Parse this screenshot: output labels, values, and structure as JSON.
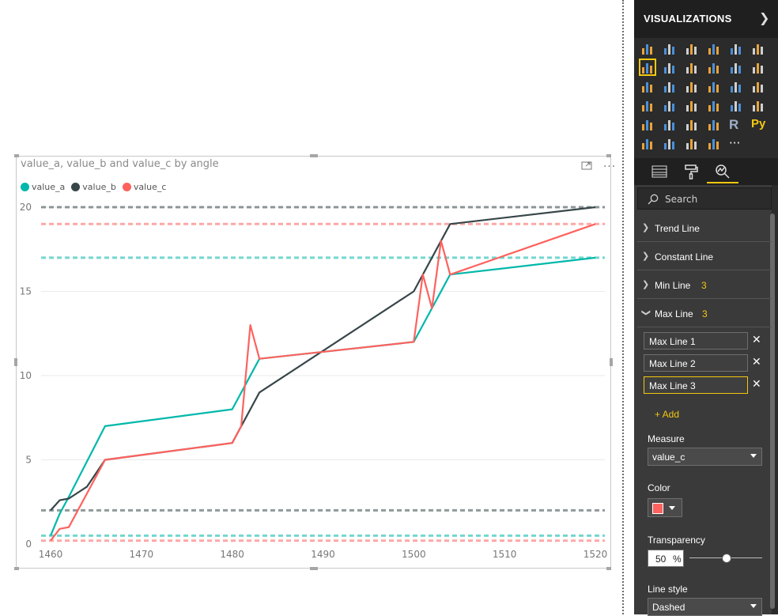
{
  "visual": {
    "title": "value_a, value_b and value_c by angle",
    "legend": [
      {
        "name": "value_a",
        "color": "#01b8aa"
      },
      {
        "name": "value_b",
        "color": "#374649"
      },
      {
        "name": "value_c",
        "color": "#fd625e"
      }
    ],
    "icons": {
      "focus": "focus-mode-icon",
      "more": "more-options-icon"
    }
  },
  "chart_data": {
    "type": "line",
    "xlim": [
      1459,
      1521
    ],
    "ylim": [
      0,
      20
    ],
    "x_ticks": [
      1460,
      1470,
      1480,
      1490,
      1500,
      1510,
      1520
    ],
    "y_ticks": [
      0,
      5,
      10,
      15,
      20
    ],
    "grid": true,
    "legend_position": "top-left",
    "series": [
      {
        "name": "value_a",
        "color": "#01b8aa",
        "points": [
          [
            1460,
            0.5
          ],
          [
            1461,
            1.8
          ],
          [
            1462,
            2.8
          ],
          [
            1466,
            7
          ],
          [
            1480,
            8
          ],
          [
            1483,
            11
          ],
          [
            1500,
            12
          ],
          [
            1504,
            16
          ],
          [
            1520,
            17
          ]
        ]
      },
      {
        "name": "value_b",
        "color": "#374649",
        "points": [
          [
            1460,
            2
          ],
          [
            1461,
            2.6
          ],
          [
            1462,
            2.7
          ],
          [
            1464,
            3.4
          ],
          [
            1466,
            5
          ],
          [
            1480,
            6
          ],
          [
            1483,
            9
          ],
          [
            1500,
            15
          ],
          [
            1504,
            19
          ],
          [
            1520,
            20
          ]
        ]
      },
      {
        "name": "value_c",
        "color": "#fd625e",
        "points": [
          [
            1460,
            0.2
          ],
          [
            1461,
            0.9
          ],
          [
            1462,
            1
          ],
          [
            1466,
            5
          ],
          [
            1480,
            6
          ],
          [
            1481,
            7
          ],
          [
            1482,
            13
          ],
          [
            1483,
            11
          ],
          [
            1500,
            12
          ],
          [
            1501,
            16
          ],
          [
            1502,
            14
          ],
          [
            1503,
            18
          ],
          [
            1504,
            16
          ],
          [
            1520,
            19
          ]
        ]
      }
    ],
    "reference_lines": [
      {
        "series": "value_b",
        "value": 20,
        "color": "#374649"
      },
      {
        "series": "value_c",
        "value": 19,
        "color": "#fd625e"
      },
      {
        "series": "value_a",
        "value": 17,
        "color": "#01b8aa"
      },
      {
        "series": "value_b",
        "value": 2,
        "color": "#374649"
      },
      {
        "series": "value_a",
        "value": 0.5,
        "color": "#01b8aa"
      },
      {
        "series": "value_c",
        "value": 0.2,
        "color": "#fd625e"
      }
    ]
  },
  "pane": {
    "title": "VISUALIZATIONS",
    "search_placeholder": "Search",
    "sections": [
      {
        "label": "Trend Line",
        "count": ""
      },
      {
        "label": "Constant Line",
        "count": ""
      },
      {
        "label": "Min Line",
        "count": "3"
      },
      {
        "label": "Max Line",
        "count": "3"
      }
    ],
    "max_lines": [
      "Max Line 1",
      "Max Line 2",
      "Max Line 3"
    ],
    "add_label": "+ Add",
    "measure_label": "Measure",
    "measure_value": "value_c",
    "color_label": "Color",
    "color_value": "#fd625e",
    "transparency_label": "Transparency",
    "transparency_value": "50",
    "transparency_unit": "%",
    "transparency_fraction": 0.5,
    "linestyle_label": "Line style",
    "linestyle_value": "Dashed",
    "gallery_extra": "R",
    "gallery_py": "Py",
    "gallery_more": "···"
  }
}
